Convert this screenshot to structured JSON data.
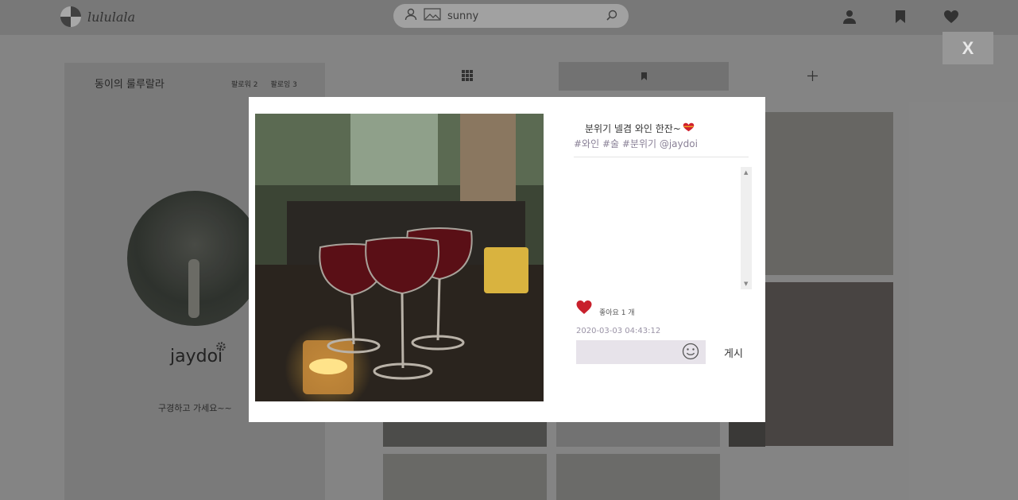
{
  "app": {
    "logo_text": "lululala"
  },
  "search": {
    "value": "sunny"
  },
  "header_icons": [
    "user-icon",
    "bookmark-icon",
    "heart-icon"
  ],
  "close_button": {
    "label": "X"
  },
  "profile": {
    "title": "동이의 룰루랄라",
    "followers": "팔로워 2",
    "following": "팔로잉 3",
    "username": "jaydoi",
    "bio": "구경하고 가세요~~"
  },
  "tabs": [
    "grid-icon",
    "bookmark-icon",
    "plus-icon"
  ],
  "post": {
    "caption": "분위기 넬겸 와인 한잔~",
    "tags": "#와인 #술 #분위기 @jaydoi",
    "likes": "좋아요 1 개",
    "date": "2020-03-03 04:43:12",
    "comment_placeholder": "",
    "post_button": "게시"
  },
  "colors": {
    "like_red": "#c8202c",
    "tag_purple": "#8a8197",
    "modal_bg": "#ffffff"
  }
}
